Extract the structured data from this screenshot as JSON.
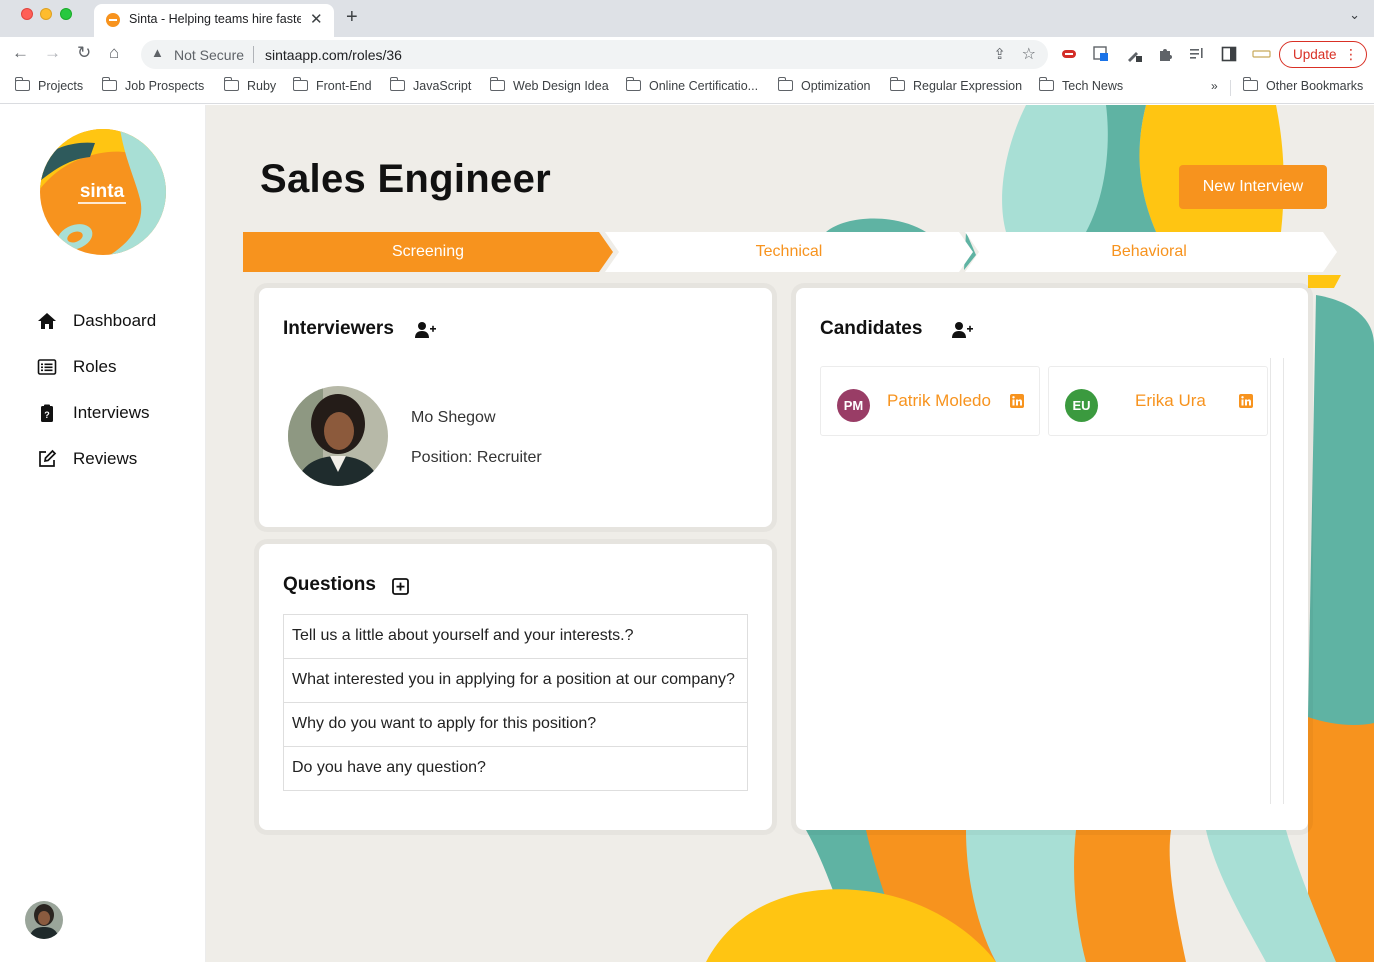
{
  "browser": {
    "tab_title": "Sinta - Helping teams hire faster",
    "security_label": "Not Secure",
    "url": "sintaapp.com/roles/36",
    "update_label": "Update",
    "bookmarks": [
      "Projects",
      "Job Prospects",
      "Ruby",
      "Front-End",
      "JavaScript",
      "Web Design Idea",
      "Online Certificatio...",
      "Optimization",
      "Regular Expression",
      "Tech News"
    ],
    "bookmarks_more": "»",
    "other_bookmarks": "Other Bookmarks"
  },
  "sidebar": {
    "logo_text": "sinta",
    "nav": [
      {
        "label": "Dashboard",
        "icon": "home-icon"
      },
      {
        "label": "Roles",
        "icon": "list-icon"
      },
      {
        "label": "Interviews",
        "icon": "clipboard-icon"
      },
      {
        "label": "Reviews",
        "icon": "edit-icon"
      }
    ]
  },
  "role": {
    "title": "Sales Engineer",
    "new_interview_label": "New Interview",
    "stages": [
      {
        "label": "Screening",
        "active": true
      },
      {
        "label": "Technical",
        "active": false
      },
      {
        "label": "Behavioral",
        "active": false
      }
    ]
  },
  "interviewers": {
    "title": "Interviewers",
    "items": [
      {
        "name": "Mo Shegow",
        "position": "Position: Recruiter"
      }
    ]
  },
  "questions": {
    "title": "Questions",
    "items": [
      "Tell us a little about yourself and your interests.?",
      "What interested you in applying for a position at our company?",
      "Why do you want to apply for this position?",
      "Do you have any question?"
    ]
  },
  "candidates": {
    "title": "Candidates",
    "items": [
      {
        "initials": "PM",
        "name": "Patrik Moledo",
        "color": "#993d66"
      },
      {
        "initials": "EU",
        "name": "Erika Ura",
        "color": "#3b9a3f"
      }
    ]
  },
  "colors": {
    "accent": "#f7931e",
    "teal": "#a8dfd5",
    "teal_dark": "#5fb3a3",
    "yellow": "#ffc512"
  }
}
